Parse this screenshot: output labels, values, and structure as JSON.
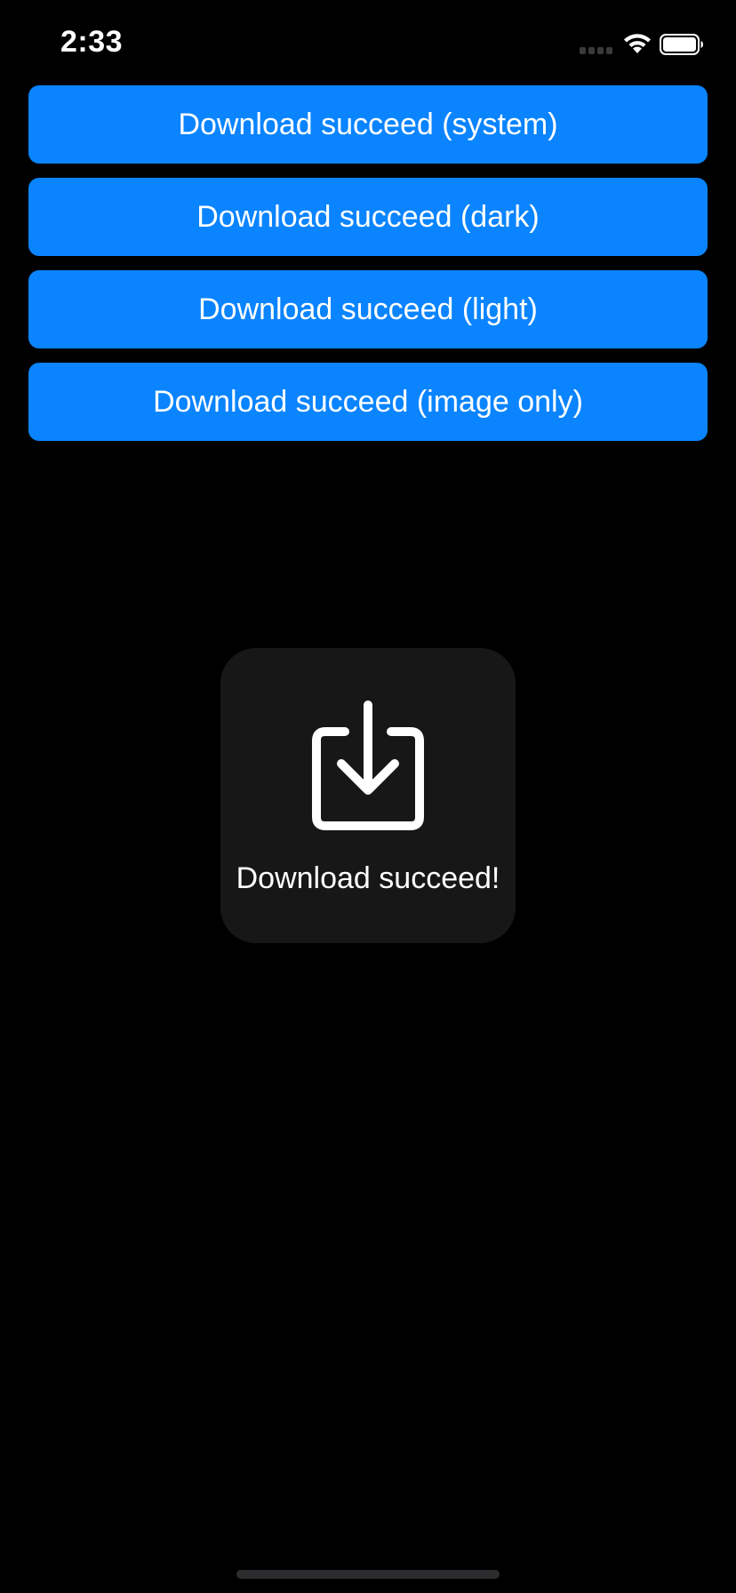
{
  "status_bar": {
    "time": "2:33",
    "icons": [
      "cellular-signal-icon",
      "wifi-icon",
      "battery-icon"
    ]
  },
  "buttons": [
    {
      "label": "Download succeed (system)"
    },
    {
      "label": "Download succeed (dark)"
    },
    {
      "label": "Download succeed (light)"
    },
    {
      "label": "Download succeed (image only)"
    }
  ],
  "hud": {
    "icon": "download-tray-icon",
    "message": "Download succeed!"
  },
  "colors": {
    "background": "#000000",
    "button_accent": "#0a84ff",
    "hud_background": "#171717",
    "text": "#ffffff"
  }
}
